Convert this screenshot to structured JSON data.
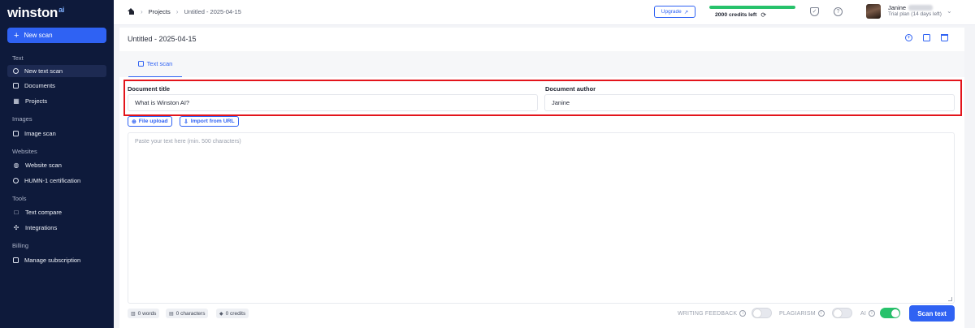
{
  "app": {
    "logo_text": "winston",
    "logo_suffix": "ai"
  },
  "sidebar": {
    "new_scan_label": "New scan",
    "sections": [
      {
        "title": "Text",
        "items": [
          {
            "label": "New text scan",
            "icon": "plus-circle-icon",
            "active": true
          },
          {
            "label": "Documents",
            "icon": "document-icon"
          },
          {
            "label": "Projects",
            "icon": "grid-icon"
          }
        ]
      },
      {
        "title": "Images",
        "items": [
          {
            "label": "Image scan",
            "icon": "image-icon"
          }
        ]
      },
      {
        "title": "Websites",
        "items": [
          {
            "label": "Website scan",
            "icon": "globe-icon"
          },
          {
            "label": "HUMN-1 certification",
            "icon": "check-circle-icon"
          }
        ]
      },
      {
        "title": "Tools",
        "items": [
          {
            "label": "Text compare",
            "icon": "book-icon"
          },
          {
            "label": "Integrations",
            "icon": "puzzle-icon"
          }
        ]
      },
      {
        "title": "Billing",
        "items": [
          {
            "label": "Manage subscription",
            "icon": "card-icon"
          }
        ]
      }
    ]
  },
  "topbar": {
    "breadcrumb": {
      "home_icon": "home-icon",
      "projects": "Projects",
      "current": "Untitled - 2025-04-15"
    },
    "upgrade_label": "Upgrade",
    "credits": {
      "text": "2000 credits left",
      "fraction": 1.0,
      "color": "#27c26b"
    },
    "user": {
      "name": "Janine",
      "plan": "Trial plan (14 days left)"
    }
  },
  "document": {
    "title": "Untitled - 2025-04-15",
    "tab_label": "Text scan",
    "fields": {
      "title_label": "Document title",
      "title_value": "What is Winston AI?",
      "author_label": "Document author",
      "author_value": "Janine"
    },
    "buttons": {
      "file_upload": "File upload",
      "import_url": "Import from URL"
    },
    "text_placeholder": "Paste your text here (min. 500 characters)",
    "stats": {
      "words": "0 words",
      "characters": "0 characters",
      "credits": "0 credits"
    },
    "options": {
      "writing_feedback": {
        "label": "WRITING FEEDBACK",
        "on": false
      },
      "plagiarism": {
        "label": "PLAGIARISM",
        "on": false
      },
      "ai": {
        "label": "AI",
        "on": true
      }
    },
    "scan_label": "Scan text"
  },
  "colors": {
    "accent": "#2f62f3",
    "sidebar": "#0e1a3b",
    "success": "#27c26b",
    "highlight": "#e3141b"
  }
}
